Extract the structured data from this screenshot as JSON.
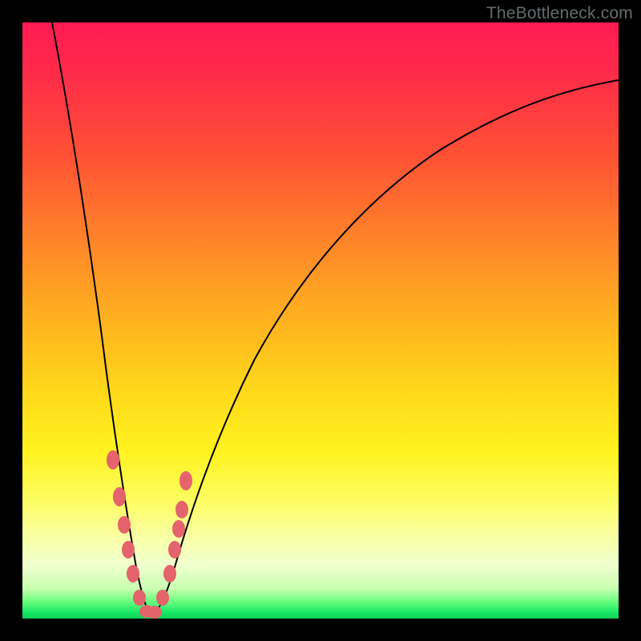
{
  "watermark": "TheBottleneck.com",
  "chart_data": {
    "type": "line",
    "title": "",
    "xlabel": "",
    "ylabel": "",
    "xlim": [
      0,
      100
    ],
    "ylim": [
      0,
      100
    ],
    "grid": false,
    "legend": false,
    "series": [
      {
        "name": "bottleneck-curve",
        "x": [
          5,
          7,
          9,
          11,
          13,
          15,
          16,
          17,
          18,
          19,
          20,
          21,
          23,
          26,
          30,
          35,
          42,
          50,
          60,
          72,
          85,
          100
        ],
        "y": [
          100,
          82,
          66,
          52,
          39,
          27,
          21,
          15,
          9,
          4,
          1,
          0,
          2,
          8,
          18,
          30,
          43,
          55,
          65,
          74,
          81,
          86
        ]
      }
    ],
    "markers": {
      "name": "highlighted-points",
      "x": [
        14.8,
        16.0,
        16.8,
        17.4,
        18.2,
        19.4,
        20.5,
        21.6,
        23.2,
        24.4,
        25.2,
        25.7,
        26.2,
        26.7
      ],
      "y": [
        26,
        20,
        15,
        11,
        7,
        3,
        1,
        1,
        4,
        8,
        12,
        15,
        18,
        23
      ]
    },
    "background_gradient": {
      "top": "#ff1a52",
      "mid": "#fff21f",
      "bottom": "#11d059"
    }
  }
}
